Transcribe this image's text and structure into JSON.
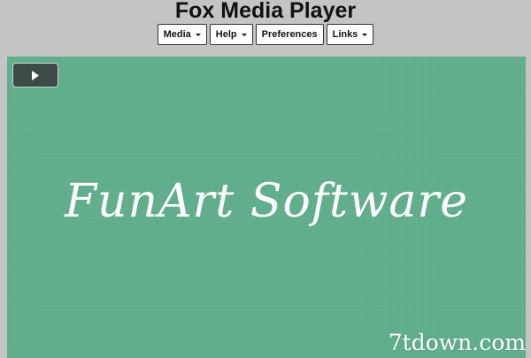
{
  "app": {
    "title": "Fox Media Player"
  },
  "menubar": {
    "items": [
      {
        "label": "Media",
        "has_dropdown": true
      },
      {
        "label": "Help",
        "has_dropdown": true
      },
      {
        "label": "Preferences",
        "has_dropdown": false
      },
      {
        "label": "Links",
        "has_dropdown": true
      }
    ]
  },
  "player": {
    "play_icon": "play-icon",
    "splash_text": "FunArt Software",
    "background_color": "#61ae8c"
  },
  "watermark": {
    "text": "7tdown.com"
  }
}
